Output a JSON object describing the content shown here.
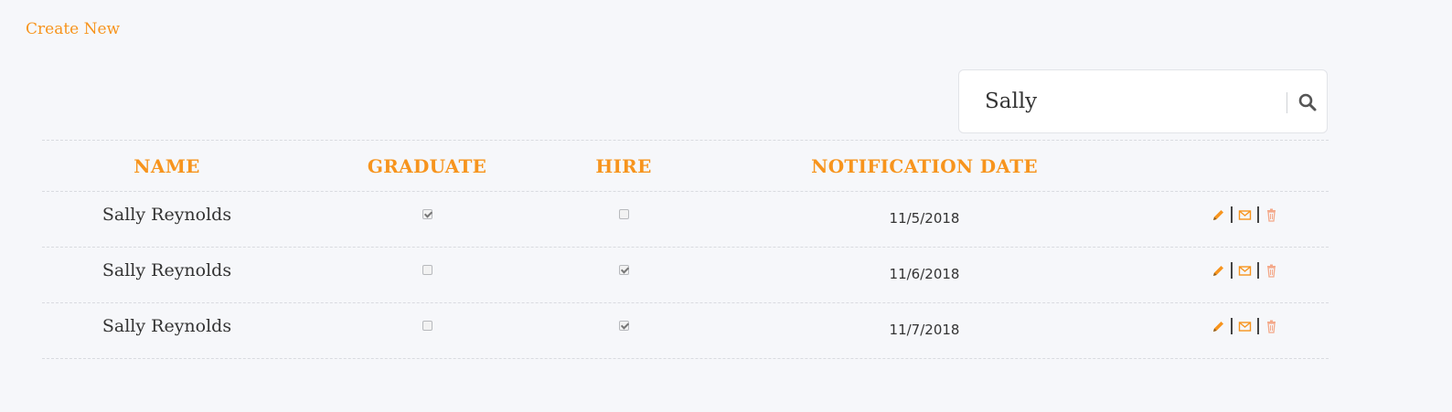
{
  "create_new": "Create New",
  "search": {
    "value": "Sally",
    "placeholder": ""
  },
  "table": {
    "headers": [
      "NAME",
      "GRADUATE",
      "HIRE",
      "NOTIFICATION DATE"
    ],
    "rows": [
      {
        "name": "Sally Reynolds",
        "graduate": true,
        "hire": false,
        "date": "11/5/2018"
      },
      {
        "name": "Sally Reynolds",
        "graduate": false,
        "hire": true,
        "date": "11/6/2018"
      },
      {
        "name": "Sally Reynolds",
        "graduate": false,
        "hire": true,
        "date": "11/7/2018"
      }
    ]
  },
  "icons": {
    "edit": "pencil-icon",
    "email": "envelope-icon",
    "delete": "trash-icon",
    "search": "search-icon"
  },
  "colors": {
    "accent": "#f7941d",
    "delete": "#f4a98a",
    "background": "#f6f7fa"
  }
}
